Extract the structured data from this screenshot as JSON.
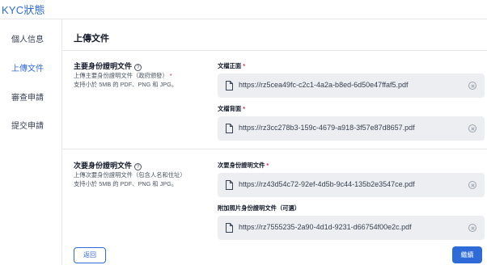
{
  "app": {
    "title": "KYC狀態"
  },
  "sidebar": {
    "items": [
      {
        "label": "個人信息"
      },
      {
        "label": "上傳文件"
      },
      {
        "label": "審查申請"
      },
      {
        "label": "提交申請"
      }
    ]
  },
  "main": {
    "section_title": "上傳文件",
    "primary": {
      "title": "主要身份證明文件",
      "desc_line1": "上傳主要身份證明文件（政府頒發）",
      "desc_required": "*",
      "desc_line2": "支持小於 5MB 的 PDF、PNG 和 JPG。",
      "front": {
        "label": "文檔正面",
        "required": "*",
        "file": "https://rz5cea49fc-c2c1-4a2a-b8ed-6d50e47ffaf5.pdf"
      },
      "back": {
        "label": "文檔背面",
        "required": "*",
        "file": "https://rz3cc278b3-159c-4679-a918-3f57e87d8657.pdf"
      }
    },
    "secondary": {
      "title": "次要身份證明文件",
      "desc_line1": "上傳次要身份證明文件（包含人名和住址）",
      "desc_line2": "支持小於 5MB 的 PDF、PNG 和 JPG。",
      "doc": {
        "label": "次要身份證明文件",
        "required": "*",
        "file": "https://rz43d54c72-92ef-4d5b-9c44-135b2e3547ce.pdf"
      },
      "photo": {
        "label": "附加照片身份證明文件（可選）",
        "file": "https://rz7555235-2a90-4d1d-9231-d66754f00e2c.pdf"
      }
    }
  },
  "actions": {
    "back_label": "返回",
    "continue_label": "繼續"
  },
  "icons": {
    "help": "question-circle-icon",
    "file": "document-icon",
    "clear": "clear-circle-x-icon"
  },
  "colors": {
    "accent": "#2f6bd8",
    "required": "#e11d48",
    "file_box_bg": "#eceef1"
  }
}
